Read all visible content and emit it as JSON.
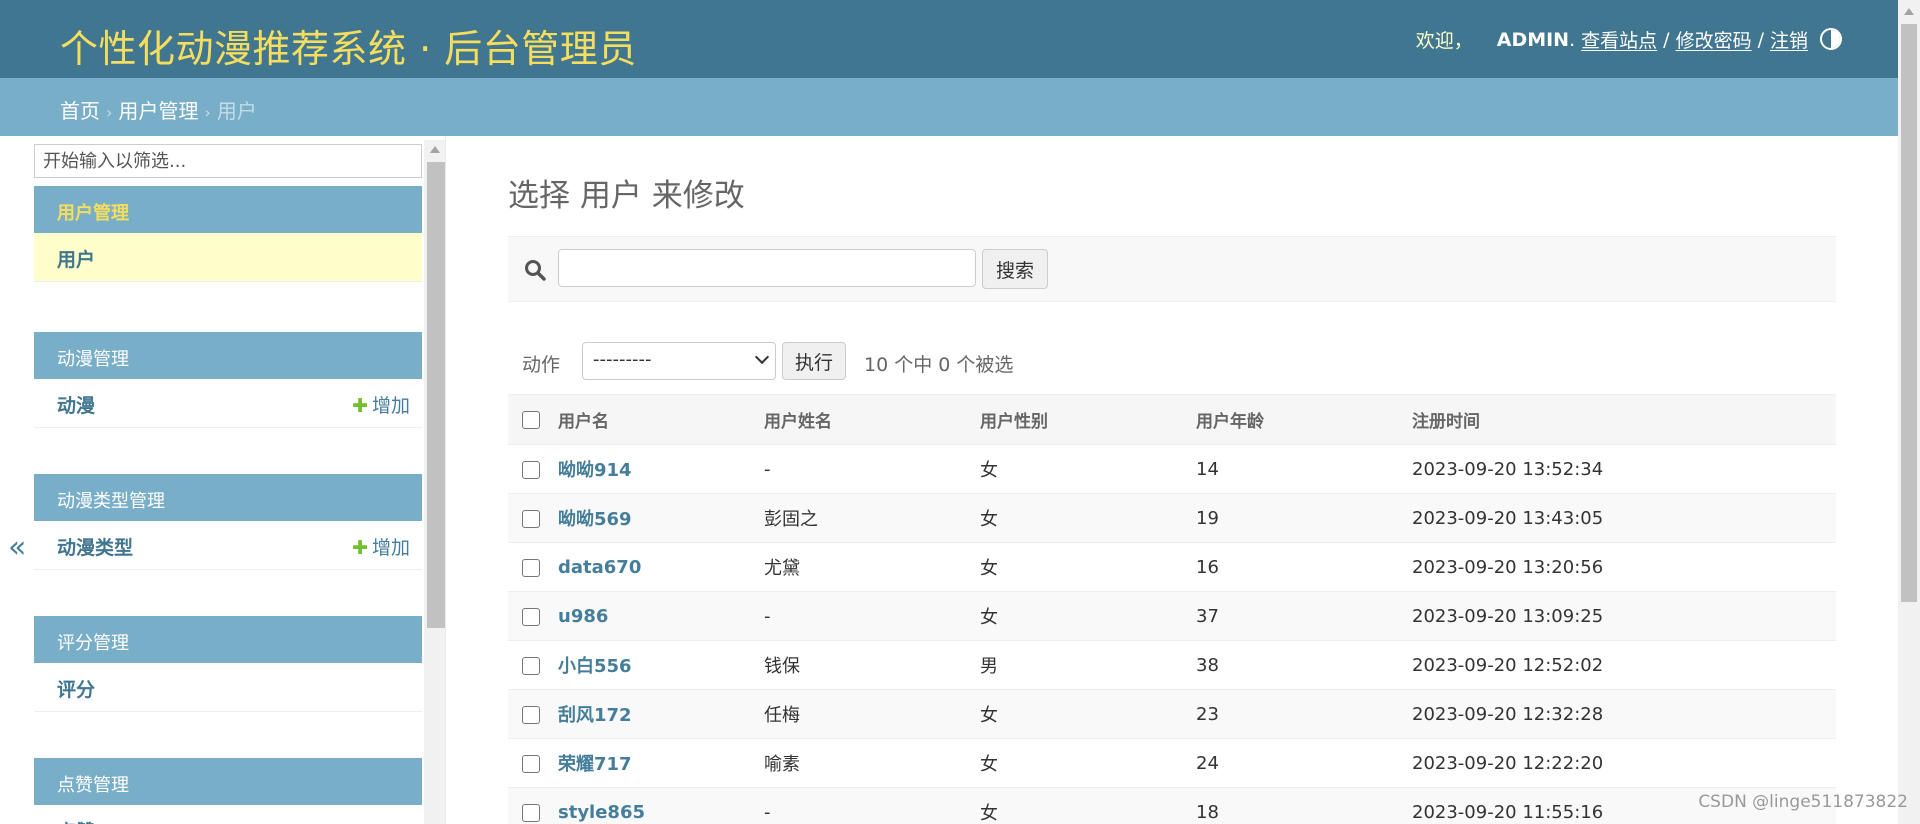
{
  "header": {
    "site_name": "个性化动漫推荐系统 · 后台管理员",
    "welcome": "欢迎，",
    "username": "ADMIN",
    "view_site": "查看站点",
    "change_password": "修改密码",
    "logout": "注销",
    "separator": "/"
  },
  "breadcrumbs": {
    "home": "首页",
    "app": "用户管理",
    "current": "用户",
    "arrow": "›"
  },
  "sidebar": {
    "filter_placeholder": "开始输入以筛选...",
    "collapse": "«",
    "add_label": "增加",
    "modules": [
      {
        "caption": "用户管理",
        "item": "用户"
      },
      {
        "caption": "动漫管理",
        "item": "动漫"
      },
      {
        "caption": "动漫类型管理",
        "item": "动漫类型"
      },
      {
        "caption": "评分管理",
        "item": "评分"
      },
      {
        "caption": "点赞管理",
        "item": "点赞"
      }
    ]
  },
  "content": {
    "title": "选择 用户 来修改",
    "search_button": "搜索",
    "actions_label": "动作",
    "action_selected": "---------",
    "go_button": "执行",
    "selection_count": "10 个中 0 个被选",
    "columns": [
      "用户名",
      "用户姓名",
      "用户性别",
      "用户年龄",
      "注册时间"
    ],
    "rows": [
      [
        "呦呦914",
        "-",
        "女",
        "14",
        "2023-09-20 13:52:34"
      ],
      [
        "呦呦569",
        "彭固之",
        "女",
        "19",
        "2023-09-20 13:43:05"
      ],
      [
        "data670",
        "尤黛",
        "女",
        "16",
        "2023-09-20 13:20:56"
      ],
      [
        "u986",
        "-",
        "女",
        "37",
        "2023-09-20 13:09:25"
      ],
      [
        "小白556",
        "钱保",
        "男",
        "38",
        "2023-09-20 12:52:02"
      ],
      [
        "刮风172",
        "任梅",
        "女",
        "23",
        "2023-09-20 12:32:28"
      ],
      [
        "荣耀717",
        "喻素",
        "女",
        "24",
        "2023-09-20 12:22:20"
      ],
      [
        "style865",
        "-",
        "女",
        "18",
        "2023-09-20 11:55:16"
      ]
    ]
  },
  "watermark": "CSDN @linge511873822",
  "colors": {
    "header": "#417690",
    "breadcrumb": "#79aec8",
    "site_name": "#f5dd5d",
    "link": "#447e9b",
    "current_row": "#ffffcc"
  }
}
